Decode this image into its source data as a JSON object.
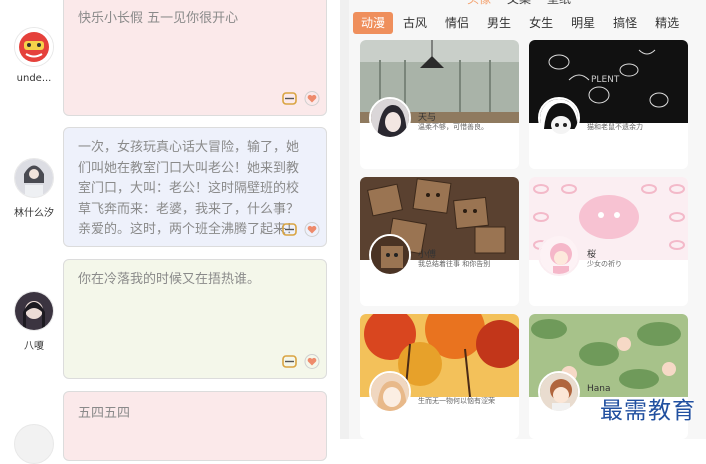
{
  "feed": [
    {
      "user": "unde...",
      "text": "快乐小长假 五一见你很开心",
      "bg": "#fbe9ea"
    },
    {
      "user": "林什么汐",
      "text": "一次，女孩玩真心话大冒险，输了，她们叫她在教室门口大叫老公！她来到教室门口，大叫：老公！这时隔壁班的校草飞奔而来：老婆，我来了，什么事？亲爱的。这时，两个班全沸腾了起来！",
      "bg": "#eef1fb"
    },
    {
      "user": "八嗄",
      "text": "你在冷落我的时候又在捂热谁。",
      "bg": "#f4f7ea"
    },
    {
      "user": "",
      "text": "五四五四",
      "bg": "#fbe9ea"
    }
  ],
  "panel": {
    "top_links": [
      "头像",
      "文案",
      "壁纸"
    ],
    "tabs": [
      "动漫",
      "古风",
      "情侣",
      "男生",
      "女生",
      "明星",
      "搞怪",
      "精选"
    ],
    "active_tab": "动漫",
    "accent": "#ef8f5c",
    "tiles": [
      {
        "name": "天与",
        "desc": "温柔不够，可惜善良。"
      },
      {
        "name": "",
        "desc": "猫和老鼠不遗余力"
      },
      {
        "name": "小傅",
        "desc": "我总结着往事 和你告别"
      },
      {
        "name": "桜",
        "desc": "少女の祈り"
      },
      {
        "name": "",
        "desc": "生而无一物何以恼有涩荣"
      },
      {
        "name": "Hana",
        "desc": ""
      }
    ]
  },
  "watermark": "最需教育"
}
